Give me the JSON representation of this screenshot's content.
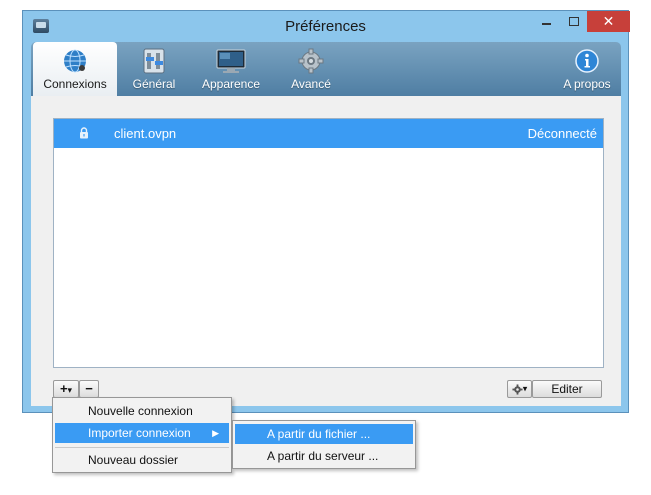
{
  "window": {
    "title": "Préférences",
    "close_glyph": "✕"
  },
  "toolbar": {
    "tabs": [
      {
        "label": "Connexions",
        "icon": "globe-network-icon",
        "active": true
      },
      {
        "label": "Général",
        "icon": "switch-panel-icon",
        "active": false
      },
      {
        "label": "Apparence",
        "icon": "monitor-icon",
        "active": false
      },
      {
        "label": "Avancé",
        "icon": "gear-icon",
        "active": false
      }
    ],
    "about": {
      "label": "A propos",
      "icon": "info-icon"
    }
  },
  "connections": [
    {
      "name": "client.ovpn",
      "status": "Déconnecté",
      "icon": "lock-icon",
      "selected": true
    }
  ],
  "buttons": {
    "add": "+",
    "add_dropdown": "▾",
    "remove": "−",
    "gear_dropdown": "▾",
    "edit": "Editer"
  },
  "context_menu": {
    "items": [
      "Nouvelle connexion",
      "Importer connexion",
      "Nouveau dossier"
    ],
    "submenu_arrow": "▶",
    "submenu": [
      "A partir du fichier ...",
      "A partir du serveur ..."
    ]
  },
  "colors": {
    "selection": "#3a9bf3",
    "window_frame": "#8cc6ec",
    "toolbar": "#5e8bad",
    "close_button": "#c7403a"
  }
}
